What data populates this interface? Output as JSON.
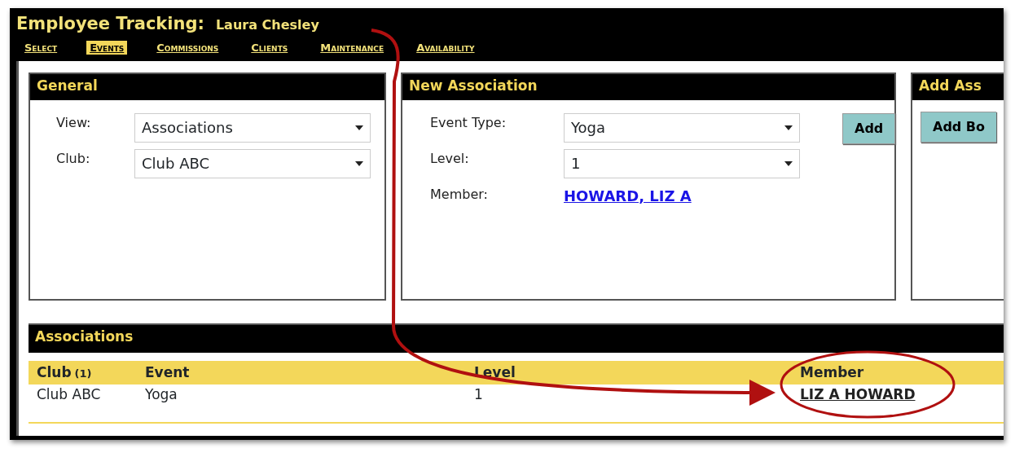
{
  "header": {
    "title": "Employee Tracking:",
    "employee": "Laura Chesley"
  },
  "tabs": [
    {
      "label": "Select",
      "selected": false
    },
    {
      "label": "Events",
      "selected": true
    },
    {
      "label": "Commissions",
      "selected": false
    },
    {
      "label": "Clients",
      "selected": false
    },
    {
      "label": "Maintenance",
      "selected": false
    },
    {
      "label": "Availability",
      "selected": false
    }
  ],
  "general": {
    "title": "General",
    "fields": [
      {
        "label": "View:",
        "value": "Associations"
      },
      {
        "label": "Club:",
        "value": "Club ABC"
      }
    ]
  },
  "new_association": {
    "title": "New Association",
    "fields": [
      {
        "label": "Event Type:",
        "value": "Yoga"
      },
      {
        "label": "Level:",
        "value": "1"
      }
    ],
    "member_label": "Member:",
    "member_link": "HOWARD, LIZ A",
    "button": "Add"
  },
  "add_panel": {
    "title": "Add Ass",
    "button": "Add Bo"
  },
  "associations": {
    "title": "Associations",
    "columns": [
      {
        "label": "Club",
        "count": "(1)"
      },
      {
        "label": "Event"
      },
      {
        "label": "Level"
      },
      {
        "label": "Member"
      }
    ],
    "rows": [
      {
        "club": "Club ABC",
        "event": "Yoga",
        "level": "1",
        "member": "LIZ A HOWARD"
      }
    ]
  }
}
